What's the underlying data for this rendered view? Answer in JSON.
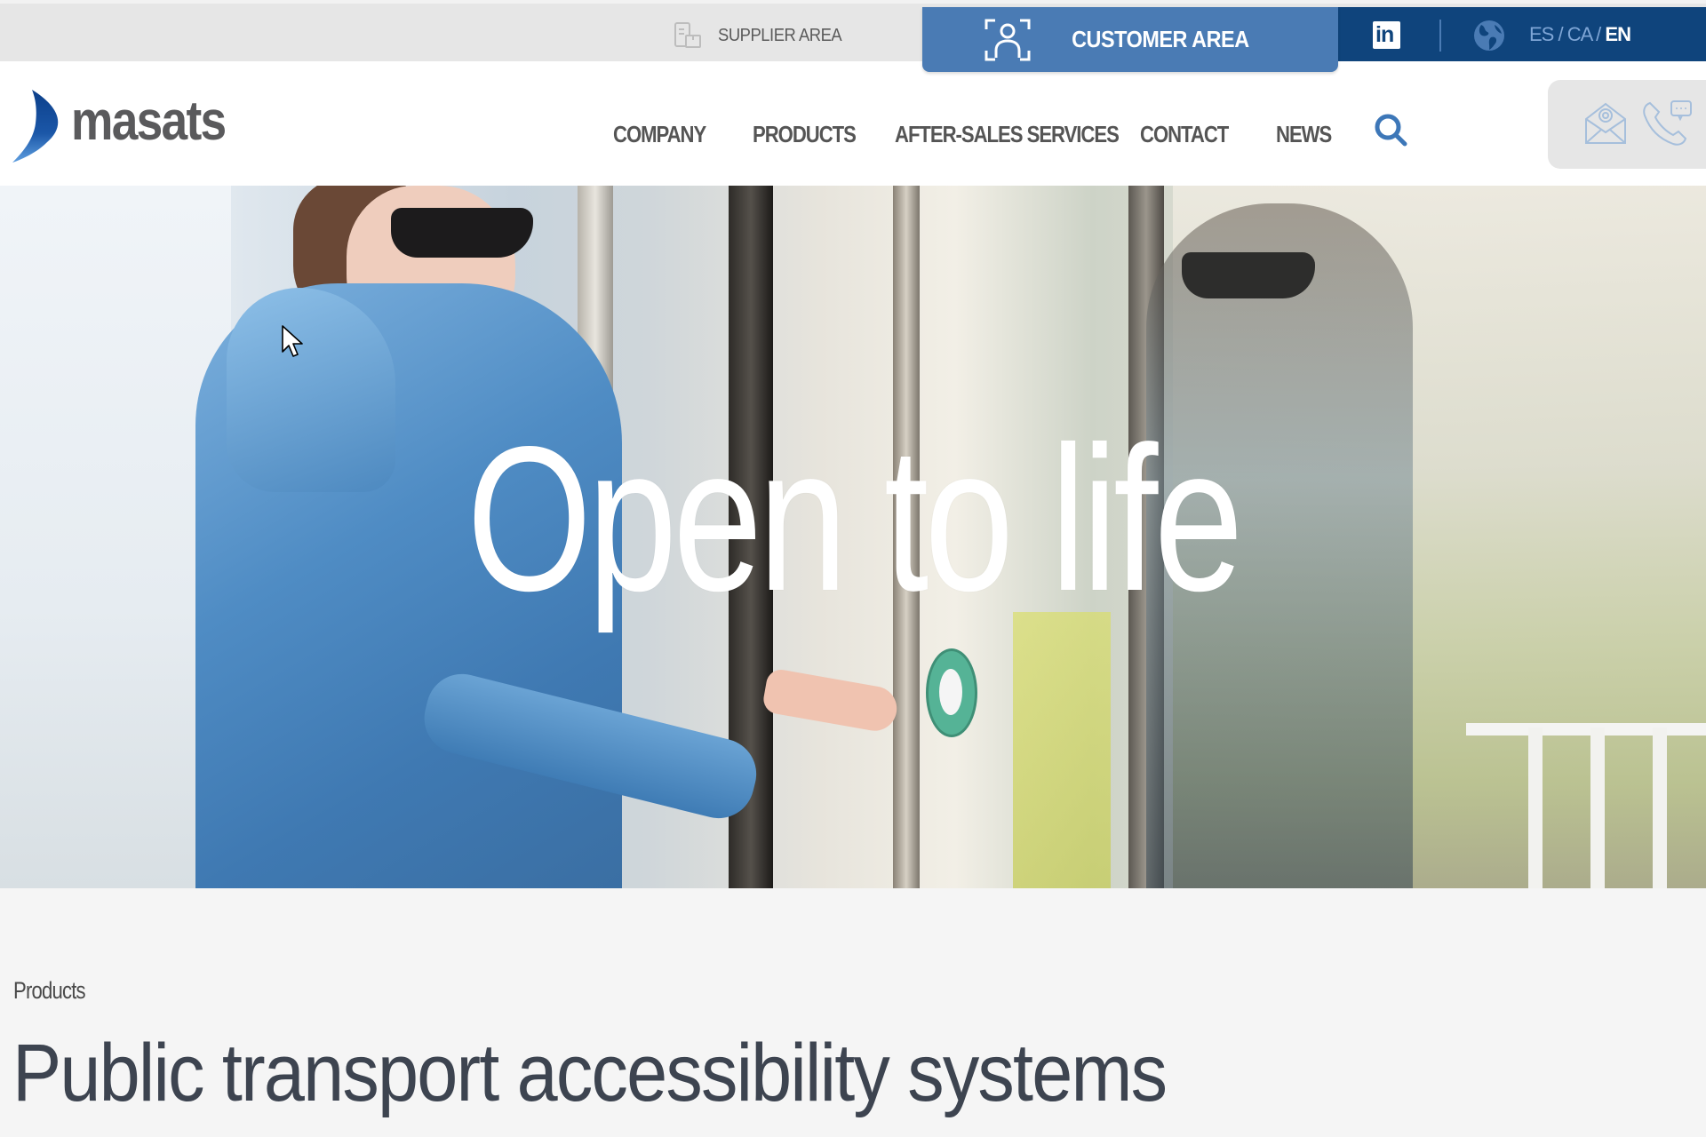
{
  "topbar": {
    "supplier_area_label": "SUPPLIER AREA",
    "customer_area_label": "CUSTOMER AREA",
    "languages": [
      {
        "code": "ES",
        "active": false
      },
      {
        "code": "CA",
        "active": false
      },
      {
        "code": "EN",
        "active": true
      }
    ],
    "lang_separator": " / ",
    "icons": {
      "supplier": "supplier-document-box-icon",
      "customer": "user-scan-icon",
      "social": "linkedin-icon",
      "language": "globe-icon"
    }
  },
  "header": {
    "logo_text": "masats",
    "nav": [
      {
        "label": "COMPANY"
      },
      {
        "label": "PRODUCTS"
      },
      {
        "label": "AFTER-SALES SERVICES"
      },
      {
        "label": "CONTACT"
      },
      {
        "label": "NEWS"
      }
    ],
    "search_icon": "search-icon",
    "contact_icons": [
      "envelope-at-icon",
      "phone-chat-icon"
    ]
  },
  "hero": {
    "title": "Open to life"
  },
  "content": {
    "breadcrumb": "Products",
    "title": "Public transport accessibility systems"
  },
  "colors": {
    "customer_blue": "#4a7bb4",
    "dark_blue": "#0f447c",
    "accent_blue": "#3d77b8",
    "topbar_gray": "#e6e6e6",
    "text_dark": "#3d4450",
    "nav_text": "#555555"
  }
}
